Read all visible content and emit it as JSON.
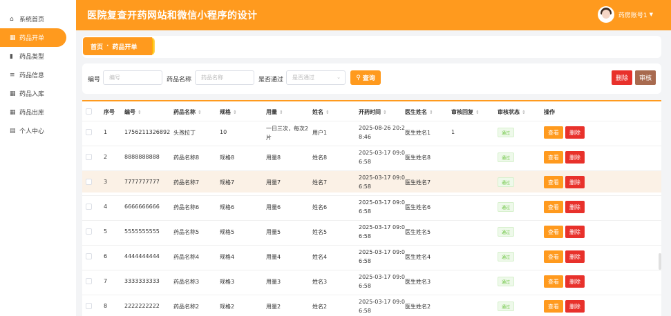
{
  "header": {
    "title": "医院复查开药网站和微信小程序的设计",
    "account": "药房账号1"
  },
  "sidebar": {
    "items": [
      {
        "label": "系统首页",
        "icon": "home-icon",
        "glyph": "⌂",
        "active": false
      },
      {
        "label": "药品开单",
        "icon": "grid-icon",
        "glyph": "▦",
        "active": true
      },
      {
        "label": "药品类型",
        "icon": "bar-chart-icon",
        "glyph": "▮",
        "active": false
      },
      {
        "label": "药品信息",
        "icon": "list-icon",
        "glyph": "≡",
        "active": false
      },
      {
        "label": "药品入库",
        "icon": "grid-icon",
        "glyph": "▦",
        "active": false
      },
      {
        "label": "药品出库",
        "icon": "grid-icon",
        "glyph": "▦",
        "active": false
      },
      {
        "label": "个人中心",
        "icon": "id-card-icon",
        "glyph": "▤",
        "active": false
      }
    ]
  },
  "breadcrumb": {
    "home": "首页",
    "separator": "·",
    "current": "药品开单"
  },
  "search": {
    "code_label": "编号",
    "code_placeholder": "编号",
    "name_label": "药品名称",
    "name_placeholder": "药品名称",
    "pass_label": "是否通过",
    "pass_placeholder": "是否通过",
    "query_button": "查询",
    "delete_button": "删除",
    "audit_button": "审核"
  },
  "table": {
    "columns": [
      "序号",
      "编号",
      "药品名称",
      "规格",
      "用量",
      "姓名",
      "开药时间",
      "医生姓名",
      "审核回复",
      "审核状态",
      "操作"
    ],
    "view_label": "查看",
    "delete_label": "删除",
    "rows": [
      {
        "no": "1",
        "code": "1756211326892",
        "name": "头孢拉丁",
        "spec": "10",
        "dose1": "一日三次，每次2",
        "dose2": "片",
        "patient": "用户1",
        "time1": "2025-08-26 20:2",
        "time2": "8:46",
        "doctor": "医生姓名1",
        "reply": "1",
        "status": "通过"
      },
      {
        "no": "2",
        "code": "8888888888",
        "name": "药品名称8",
        "spec": "规格8",
        "dose1": "用量8",
        "dose2": "",
        "patient": "姓名8",
        "time1": "2025-03-17 09:0",
        "time2": "6:58",
        "doctor": "医生姓名8",
        "reply": "",
        "status": "通过"
      },
      {
        "no": "3",
        "code": "7777777777",
        "name": "药品名称7",
        "spec": "规格7",
        "dose1": "用量7",
        "dose2": "",
        "patient": "姓名7",
        "time1": "2025-03-17 09:0",
        "time2": "6:58",
        "doctor": "医生姓名7",
        "reply": "",
        "status": "通过"
      },
      {
        "no": "4",
        "code": "6666666666",
        "name": "药品名称6",
        "spec": "规格6",
        "dose1": "用量6",
        "dose2": "",
        "patient": "姓名6",
        "time1": "2025-03-17 09:0",
        "time2": "6:58",
        "doctor": "医生姓名6",
        "reply": "",
        "status": "通过"
      },
      {
        "no": "5",
        "code": "5555555555",
        "name": "药品名称5",
        "spec": "规格5",
        "dose1": "用量5",
        "dose2": "",
        "patient": "姓名5",
        "time1": "2025-03-17 09:0",
        "time2": "6:58",
        "doctor": "医生姓名5",
        "reply": "",
        "status": "通过"
      },
      {
        "no": "6",
        "code": "4444444444",
        "name": "药品名称4",
        "spec": "规格4",
        "dose1": "用量4",
        "dose2": "",
        "patient": "姓名4",
        "time1": "2025-03-17 09:0",
        "time2": "6:58",
        "doctor": "医生姓名4",
        "reply": "",
        "status": "通过"
      },
      {
        "no": "7",
        "code": "3333333333",
        "name": "药品名称3",
        "spec": "规格3",
        "dose1": "用量3",
        "dose2": "",
        "patient": "姓名3",
        "time1": "2025-03-17 09:0",
        "time2": "6:58",
        "doctor": "医生姓名3",
        "reply": "",
        "status": "通过"
      },
      {
        "no": "8",
        "code": "2222222222",
        "name": "药品名称2",
        "spec": "规格2",
        "dose1": "用量2",
        "dose2": "",
        "patient": "姓名2",
        "time1": "2025-03-17 09:0",
        "time2": "6:58",
        "doctor": "医生姓名2",
        "reply": "",
        "status": "通过"
      }
    ]
  },
  "colors": {
    "accent": "#ff9a1e",
    "danger": "#e8312b",
    "audit": "#a86a4f",
    "success": "#67c23a"
  }
}
